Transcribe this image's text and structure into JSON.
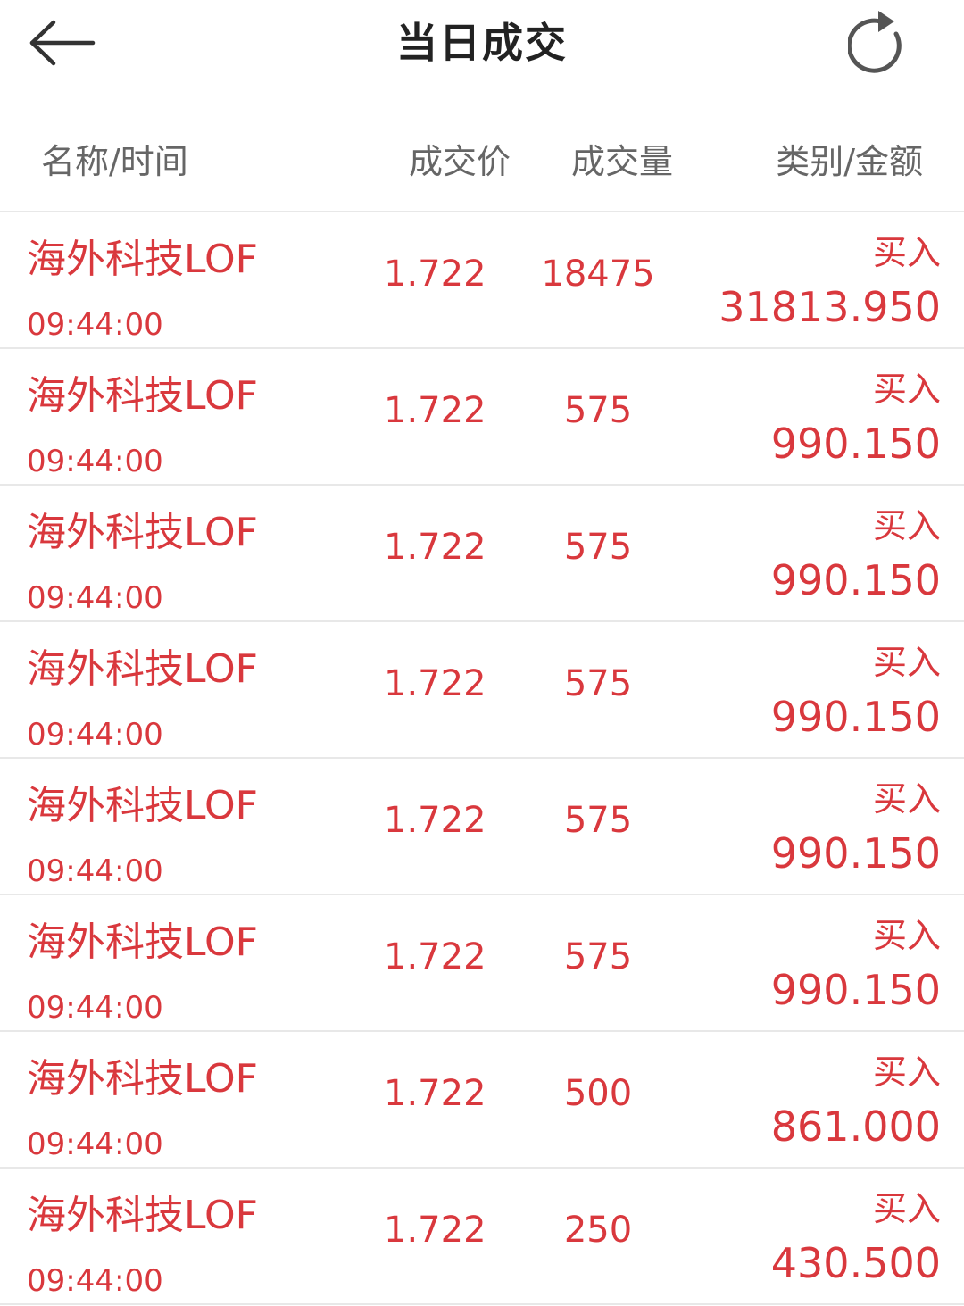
{
  "header": {
    "title": "当日成交",
    "back_icon": "arrow-left-icon",
    "refresh_icon": "refresh-icon"
  },
  "columns": {
    "name_time": "名称/时间",
    "price": "成交价",
    "volume": "成交量",
    "type_amount": "类别/金额"
  },
  "colors": {
    "buy_red": "#d9383d",
    "header_gray": "#666666",
    "divider": "#e8e8e8"
  },
  "trades": [
    {
      "name": "海外科技LOF",
      "time": "09:44:00",
      "price": "1.722",
      "volume": "18475",
      "type": "买入",
      "amount": "31813.950"
    },
    {
      "name": "海外科技LOF",
      "time": "09:44:00",
      "price": "1.722",
      "volume": "575",
      "type": "买入",
      "amount": "990.150"
    },
    {
      "name": "海外科技LOF",
      "time": "09:44:00",
      "price": "1.722",
      "volume": "575",
      "type": "买入",
      "amount": "990.150"
    },
    {
      "name": "海外科技LOF",
      "time": "09:44:00",
      "price": "1.722",
      "volume": "575",
      "type": "买入",
      "amount": "990.150"
    },
    {
      "name": "海外科技LOF",
      "time": "09:44:00",
      "price": "1.722",
      "volume": "575",
      "type": "买入",
      "amount": "990.150"
    },
    {
      "name": "海外科技LOF",
      "time": "09:44:00",
      "price": "1.722",
      "volume": "575",
      "type": "买入",
      "amount": "990.150"
    },
    {
      "name": "海外科技LOF",
      "time": "09:44:00",
      "price": "1.722",
      "volume": "500",
      "type": "买入",
      "amount": "861.000"
    },
    {
      "name": "海外科技LOF",
      "time": "09:44:00",
      "price": "1.722",
      "volume": "250",
      "type": "买入",
      "amount": "430.500"
    }
  ]
}
